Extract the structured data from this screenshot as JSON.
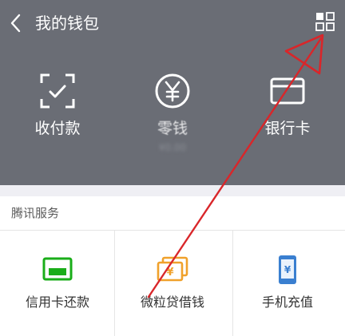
{
  "header": {
    "title": "我的钱包"
  },
  "icons": {
    "back": "chevron-left-icon",
    "more": "grid-icon",
    "pay": "scan-check-icon",
    "change": "yuan-coin-icon",
    "card": "bank-card-icon",
    "credit": "credit-card-icon",
    "loan": "money-bill-icon",
    "phone": "phone-yuan-icon"
  },
  "wallet": {
    "items": [
      {
        "label": "收付款",
        "sub": ""
      },
      {
        "label": "零钱",
        "sub": "¥0.00"
      },
      {
        "label": "银行卡",
        "sub": ""
      }
    ]
  },
  "services": {
    "title": "腾讯服务",
    "items": [
      {
        "label": "信用卡还款"
      },
      {
        "label": "微粒贷借钱"
      },
      {
        "label": "手机充值"
      }
    ]
  },
  "colors": {
    "header_bg": "#6a6d75",
    "page_bg": "#efeff4",
    "credit_green": "#1aad19",
    "loan_orange": "#f0a12b",
    "phone_blue": "#3a7fd0",
    "annotation_red": "#d9262a"
  }
}
